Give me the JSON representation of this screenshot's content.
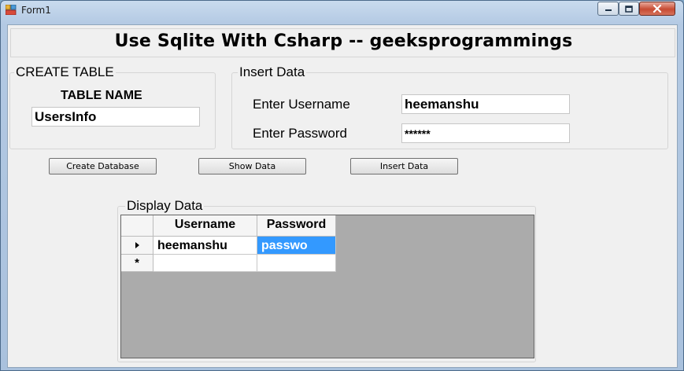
{
  "window": {
    "title": "Form1"
  },
  "header": {
    "title": "Use Sqlite With Csharp -- geeksprogrammings"
  },
  "create_table": {
    "group_title": "CREATE TABLE",
    "label": "TABLE NAME",
    "value": "UsersInfo"
  },
  "insert_data": {
    "group_title": "Insert Data",
    "username_label": "Enter Username",
    "username_value": "heemanshu",
    "password_label": "Enter Password",
    "password_value": "******"
  },
  "buttons": {
    "create_database": "Create Database",
    "show_data": "Show Data",
    "insert_data": "Insert Data"
  },
  "display": {
    "group_title": "Display Data",
    "columns": [
      "Username",
      "Password"
    ],
    "rows": [
      [
        "heemanshu",
        "passwo"
      ]
    ],
    "new_row_marker": "*"
  }
}
